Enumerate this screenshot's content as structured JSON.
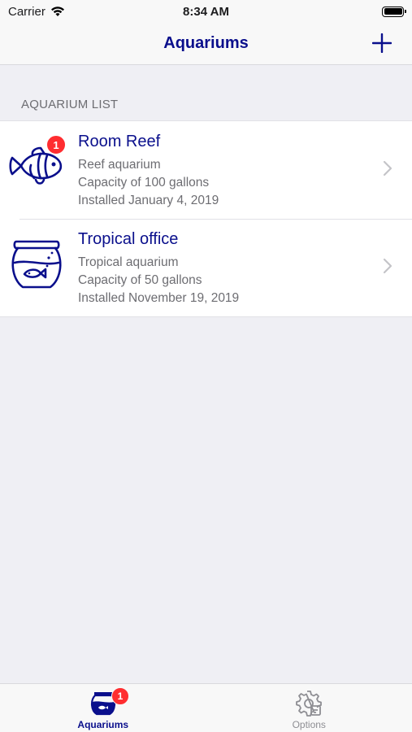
{
  "status_bar": {
    "carrier": "Carrier",
    "time": "8:34 AM"
  },
  "nav": {
    "title": "Aquariums",
    "add_icon": "plus-icon"
  },
  "section": {
    "header": "AQUARIUM LIST"
  },
  "aquariums": [
    {
      "name": "Room Reef",
      "type": "Reef aquarium",
      "capacity": "Capacity of 100 gallons",
      "installed": "Installed January 4, 2019",
      "icon": "clownfish-icon",
      "badge": "1"
    },
    {
      "name": "Tropical office",
      "type": "Tropical aquarium",
      "capacity": "Capacity of 50 gallons",
      "installed": "Installed November 19, 2019",
      "icon": "fishbowl-icon"
    }
  ],
  "tabs": [
    {
      "label": "Aquariums",
      "badge": "1",
      "icon": "fishbowl-icon",
      "active": true
    },
    {
      "label": "Options",
      "icon": "gear-icon",
      "active": false
    }
  ],
  "colors": {
    "accent": "#0a0f8c",
    "badge": "#ff2d30",
    "secondary_text": "#6d6d72"
  }
}
